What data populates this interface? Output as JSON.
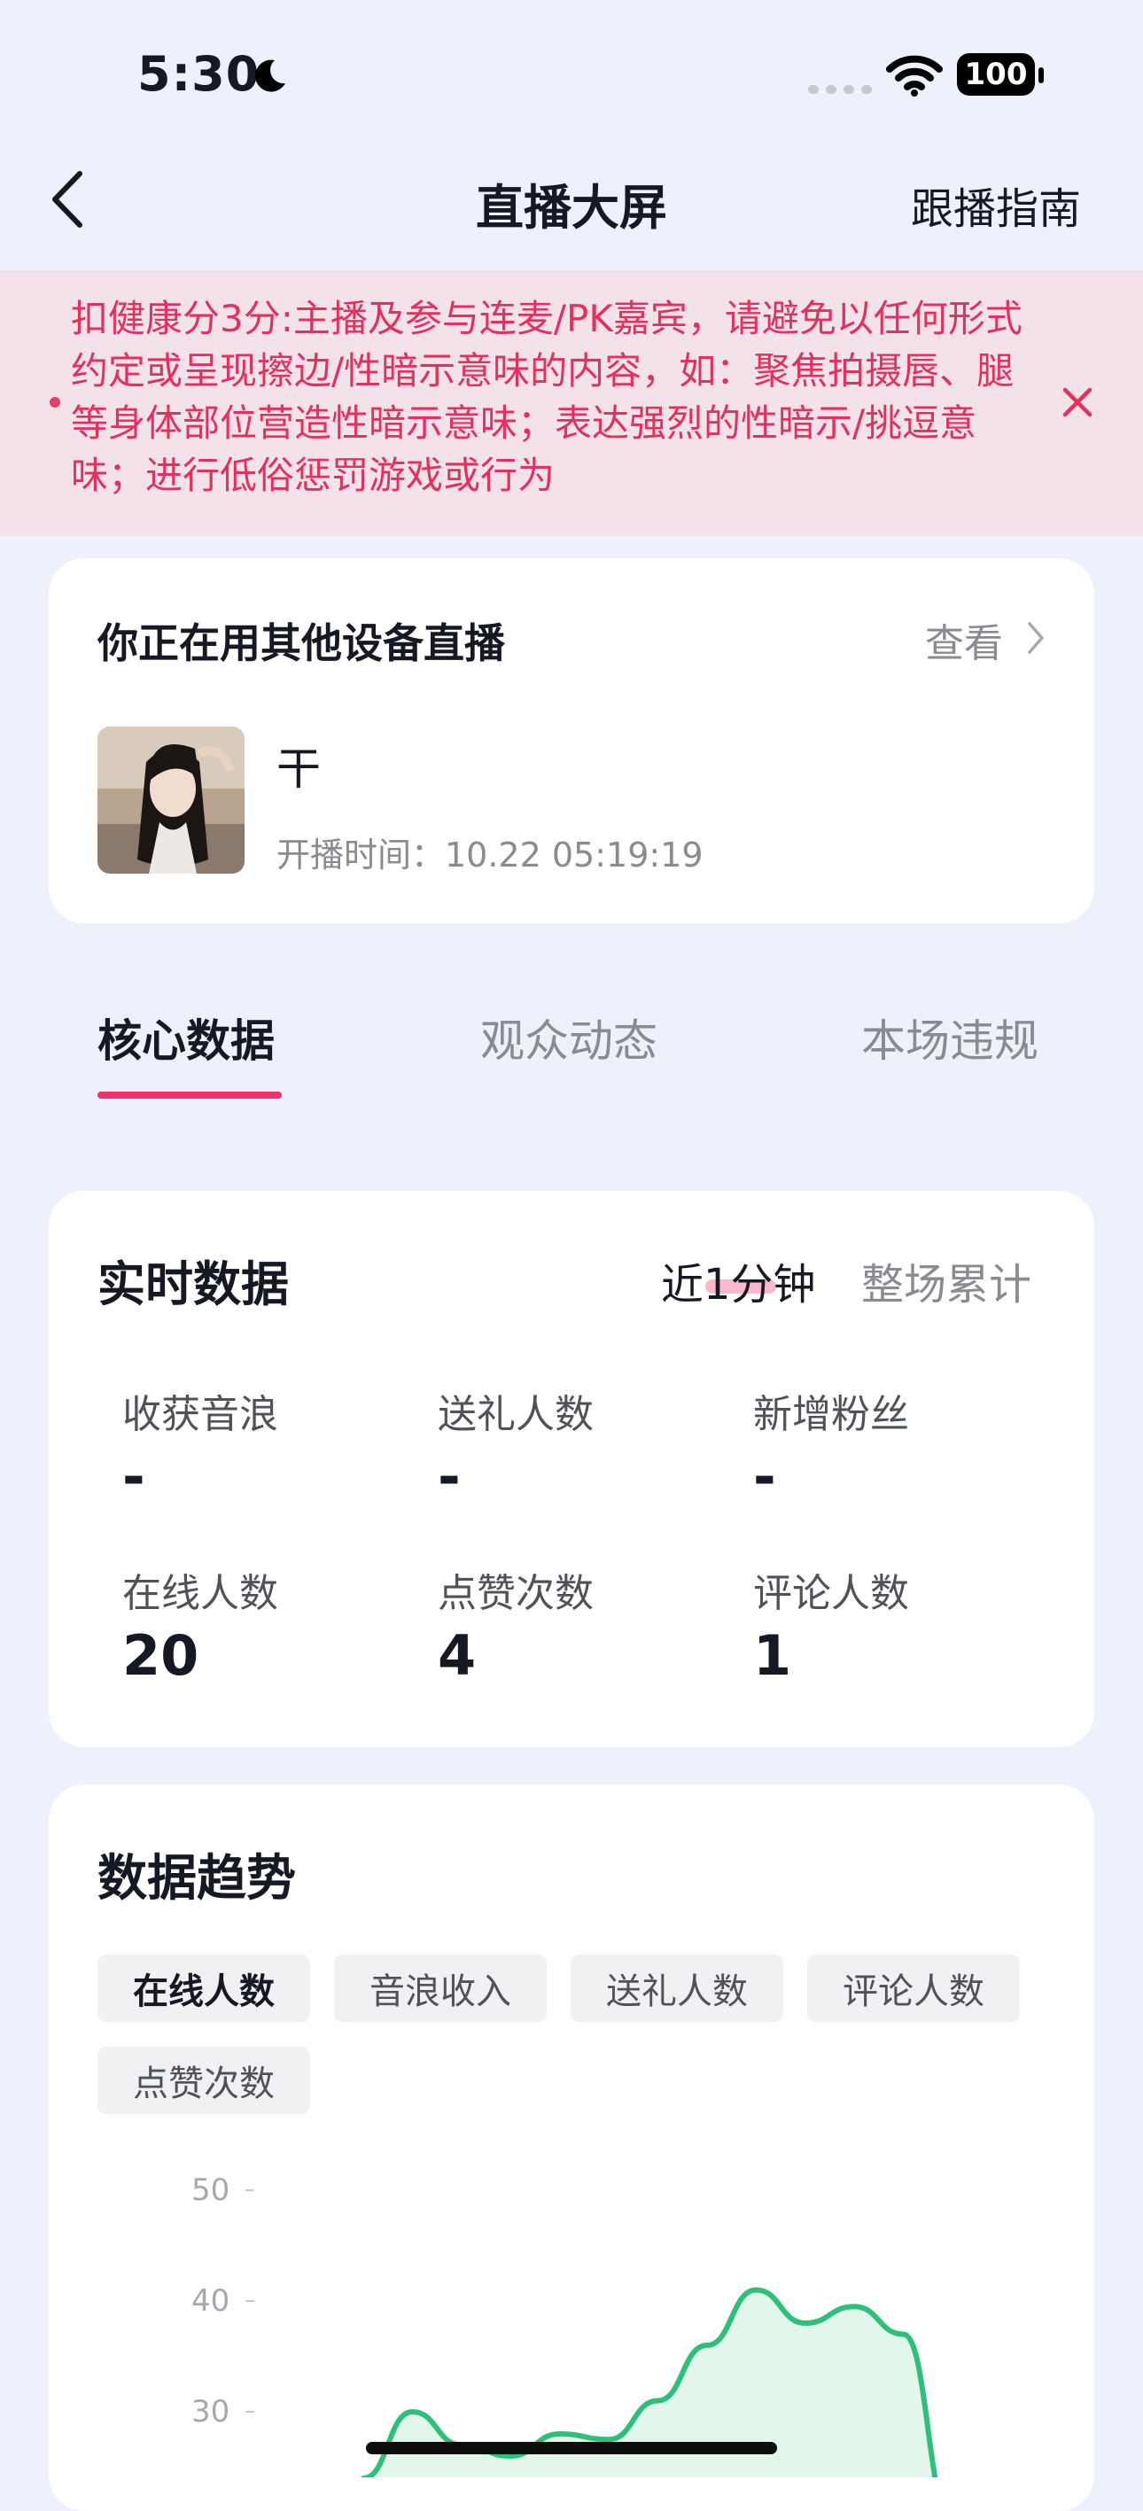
{
  "status_bar": {
    "time": "5:30",
    "battery": "100"
  },
  "header": {
    "title": "直播大屏",
    "guide_link": "跟播指南"
  },
  "warning": {
    "text": "扣健康分3分:主播及参与连麦/PK嘉宾，请避免以任何形式约定或呈现擦边/性暗示意味的内容，如：聚焦拍摄唇、腿等身体部位营造性暗示意味；表达强烈的性暗示/挑逗意味；进行低俗惩罚游戏或行为"
  },
  "device_card": {
    "title": "你正在用其他设备直播",
    "view_label": "查看",
    "streamer_name": "干",
    "start_time": "开播时间：10.22 05:19:19"
  },
  "tabs": [
    {
      "label": "核心数据",
      "active": true
    },
    {
      "label": "观众动态",
      "active": false
    },
    {
      "label": "本场违规",
      "active": false
    }
  ],
  "realtime": {
    "title": "实时数据",
    "ranges": [
      "近1分钟",
      "整场累计"
    ],
    "active_range": "近1分钟",
    "metrics": [
      {
        "label": "收获音浪",
        "value": "-"
      },
      {
        "label": "送礼人数",
        "value": "-"
      },
      {
        "label": "新增粉丝",
        "value": "-"
      },
      {
        "label": "在线人数",
        "value": "20"
      },
      {
        "label": "点赞次数",
        "value": "4"
      },
      {
        "label": "评论人数",
        "value": "1"
      }
    ]
  },
  "trend": {
    "title": "数据趋势",
    "chips": [
      "在线人数",
      "音浪收入",
      "送礼人数",
      "评论人数",
      "点赞次数"
    ],
    "active_chip": "在线人数"
  },
  "chart_data": {
    "type": "area",
    "ytick_labels": [
      "50",
      "40",
      "30"
    ],
    "ylim": [
      30,
      50
    ],
    "series": [
      {
        "values": [
          24,
          30,
          27,
          26,
          28,
          27.5,
          31,
          36,
          41,
          38,
          39.5,
          37,
          20
        ]
      }
    ],
    "color": "#2ec07a",
    "fill": "#e3f6ec"
  },
  "colors": {
    "accent": "#f0336a",
    "warning_text": "#e1325f",
    "warning_bg": "#f3e2ea",
    "page_bg": "#eef1fb"
  }
}
